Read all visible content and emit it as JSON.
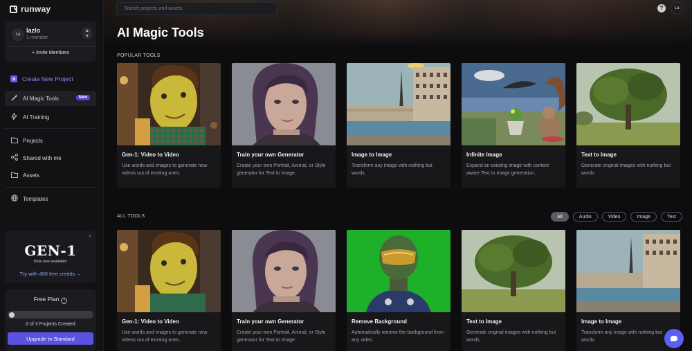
{
  "app": {
    "logo_text": "runway"
  },
  "team": {
    "avatar": "La",
    "name": "lazlo",
    "members": "1 member",
    "switch_icon": "chevron-updown-icon",
    "invite": "+ Invite Members"
  },
  "sidebar": {
    "items": [
      {
        "label": "Create New Project",
        "icon": "plus-icon"
      },
      {
        "label": "AI Magic Tools",
        "icon": "magic-wand-icon",
        "badge": "New",
        "active": true
      },
      {
        "label": "AI Training",
        "icon": "lightning-icon"
      },
      {
        "label": "Projects",
        "icon": "folder-icon"
      },
      {
        "label": "Shared with me",
        "icon": "share-icon"
      },
      {
        "label": "Assets",
        "icon": "assets-folder-icon"
      },
      {
        "label": "Templates",
        "icon": "globe-icon"
      }
    ]
  },
  "promo": {
    "logo": "GEN-1",
    "subtitle": "Beta now available!",
    "link": "Try with 400 free credits →",
    "close": "×"
  },
  "plan": {
    "title": "Free Plan",
    "info": "i",
    "count": "0 of 3 Projects Created",
    "upgrade": "Upgrade to Standard",
    "progress": 0
  },
  "topbar": {
    "search_placeholder": "Search projects and assets",
    "help": "?",
    "avatar": "La"
  },
  "page": {
    "title": "AI Magic Tools"
  },
  "popular": {
    "label": "POPULAR TOOLS",
    "cards": [
      {
        "title": "Gen-1: Video to Video",
        "desc": "Use words and images to generate new videos out of existing ones."
      },
      {
        "title": "Train your own Generator",
        "desc": "Create your own Portrait, Animal, or Style generator for Text to Image."
      },
      {
        "title": "Image to Image",
        "desc": "Transform any image with nothing but words."
      },
      {
        "title": "Infinite Image",
        "desc": "Expand an existing image with context aware Text to Image generation."
      },
      {
        "title": "Text to Image",
        "desc": "Generate original images with nothing but words."
      }
    ]
  },
  "all": {
    "label": "ALL TOOLS",
    "filters": [
      "All",
      "Audio",
      "Video",
      "Image",
      "Text"
    ],
    "active_filter": "All",
    "cards": [
      {
        "title": "Gen-1: Video to Video",
        "desc": "Use words and images to generate new videos out of existing ones."
      },
      {
        "title": "Train your own Generator",
        "desc": "Create your own Portrait, Animal, or Style generator for Text to Image."
      },
      {
        "title": "Remove Background",
        "desc": "Automatically remove the background from any video."
      },
      {
        "title": "Text to Image",
        "desc": "Generate original images with nothing but words."
      },
      {
        "title": "Image to Image",
        "desc": "Transform any image with nothing but words."
      }
    ]
  },
  "colors": {
    "accent": "#5b5ef0",
    "badge": "#5a3fd0",
    "background": "#0d0d0f",
    "link": "#8aa6ff"
  }
}
